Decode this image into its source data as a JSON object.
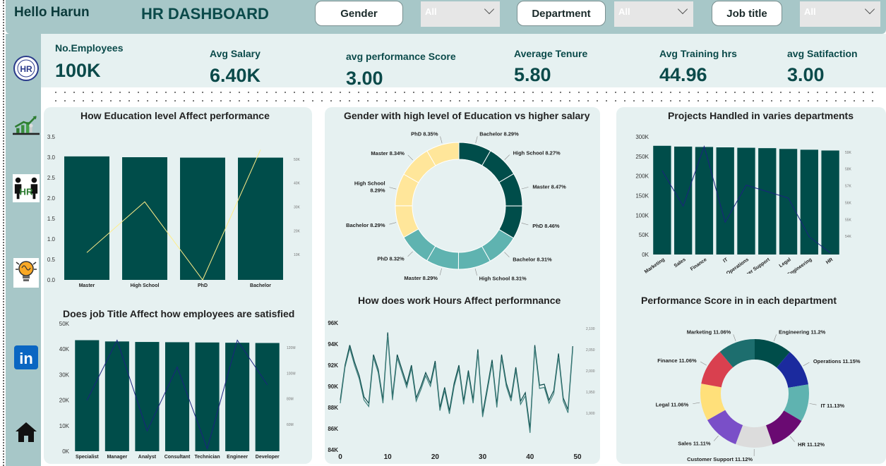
{
  "header": {
    "greeting": "Hello Harun",
    "title": "HR DASHBOARD",
    "filters": [
      {
        "label": "Gender",
        "value": "All"
      },
      {
        "label": "Department",
        "value": "All"
      },
      {
        "label": "Job  title",
        "value": "All"
      }
    ]
  },
  "sidebar": {
    "icons": [
      "hr-logo-icon",
      "growth-chart-icon",
      "hr-people-icon",
      "lightbulb-icon",
      "linkedin-icon",
      "home-icon"
    ],
    "linkedin_text": "in",
    "hr_text": "HR"
  },
  "kpis": [
    {
      "label": "No.Employees",
      "value": "100K"
    },
    {
      "label": "Avg Salary",
      "value": "6.40K"
    },
    {
      "label": "avg performance Score",
      "value": "3.00"
    },
    {
      "label": "Average Tenure",
      "value": "5.80"
    },
    {
      "label": "Avg Training hrs",
      "value": "44.96"
    },
    {
      "label": "avg Satifaction",
      "value": "3.00"
    }
  ],
  "colors": {
    "primary": "#004d4a",
    "line_yellow": "#ffee88",
    "line_blue": "#1a237e",
    "panel_bg": "#e6f1f1",
    "sidebar_bg": "#a7c7c8"
  },
  "chart_data": [
    {
      "type": "bar",
      "title": "How Education level Affect performance",
      "categories": [
        "Master",
        "High School",
        "PhD",
        "Bachelor"
      ],
      "series": [
        {
          "values": [
            3.02,
            3.0,
            2.99,
            2.99
          ]
        }
      ],
      "line": {
        "values": [
          10500,
          30000,
          0,
          50000
        ]
      },
      "ylim": [
        0,
        3.5
      ],
      "yticks": [
        "0.0",
        "0.5",
        "1.0",
        "1.5",
        "2.0",
        "2.5",
        "3.0",
        "3.5"
      ],
      "y2ticks": [
        "10K",
        "20K",
        "30K",
        "40K",
        "50K"
      ],
      "y2lim": [
        0,
        55000
      ]
    },
    {
      "type": "pie",
      "title": "Gender  with high level of Education vs higher salary",
      "slices": [
        {
          "label": "Bachelor 8.29%",
          "value": 8.29,
          "color": "#004d4a"
        },
        {
          "label": "High School 8.27%",
          "value": 8.27,
          "color": "#004d4a"
        },
        {
          "label": "Master 8.47%",
          "value": 8.47,
          "color": "#004d4a"
        },
        {
          "label": "PhD 8.46%",
          "value": 8.46,
          "color": "#004d4a"
        },
        {
          "label": "Bachelor 8.31%",
          "value": 8.31,
          "color": "#5fb3b0"
        },
        {
          "label": "High School 8.31%",
          "value": 8.31,
          "color": "#5fb3b0"
        },
        {
          "label": "Master 8.29%",
          "value": 8.29,
          "color": "#5fb3b0"
        },
        {
          "label": "PhD 8.32%",
          "value": 8.32,
          "color": "#5fb3b0"
        },
        {
          "label": "Bachelor 8.29%",
          "value": 8.29,
          "color": "#ffe69a"
        },
        {
          "label": "High School 8.29%",
          "value": 8.29,
          "color": "#ffe69a"
        },
        {
          "label": "Master 8.34%",
          "value": 8.34,
          "color": "#ffe69a"
        },
        {
          "label": "PhD 8.35%",
          "value": 8.35,
          "color": "#ffe69a"
        }
      ]
    },
    {
      "type": "bar",
      "title": "Projects Handled in varies departments",
      "categories": [
        "Marketing",
        "Sales",
        "Finance",
        "IT",
        "Operations",
        "Customer Support",
        "Legal",
        "Engineering",
        "HR"
      ],
      "series": [
        {
          "values": [
            277000,
            275000,
            274000,
            273000,
            272000,
            271000,
            269000,
            267000,
            265000
          ]
        }
      ],
      "line": {
        "values": [
          5790000,
          5570000,
          5940000,
          5470000,
          5700000,
          5660000,
          5620000,
          5380000,
          5280000
        ]
      },
      "ylim": [
        0,
        300000
      ],
      "yticks": [
        "0K",
        "50K",
        "100K",
        "150K",
        "200K",
        "250K",
        "300K"
      ],
      "y2ticks": [
        "54K",
        "55K",
        "56K",
        "57K",
        "58K",
        "59K"
      ],
      "y2lim": [
        5270000,
        6000000
      ]
    },
    {
      "type": "bar",
      "title": "Does job Title Affect how employees are satisfied",
      "categories": [
        "Specialist",
        "Manager",
        "Analyst",
        "Consultant",
        "Technician",
        "Engineer",
        "Developer"
      ],
      "series": [
        {
          "values": [
            43500,
            43000,
            42800,
            42700,
            42600,
            42500,
            42400
          ]
        }
      ],
      "line": {
        "values": [
          40000,
          87000,
          16000,
          66000,
          2000,
          87000,
          52000
        ]
      },
      "ylim": [
        0,
        50000
      ],
      "yticks": [
        "0K",
        "10K",
        "20K",
        "30K",
        "40K",
        "50K"
      ],
      "y2ticks": [
        "60M",
        "80M",
        "100M",
        "120M"
      ],
      "y2lim": [
        0,
        100000
      ]
    },
    {
      "type": "line",
      "title": "How does work Hours Affect performnance",
      "xlim": [
        0,
        50
      ],
      "xticks": [
        "0",
        "10",
        "20",
        "30",
        "40",
        "50"
      ],
      "ylim": [
        84000,
        96000
      ],
      "yticks": [
        "84K",
        "86K",
        "88K",
        "90K",
        "92K",
        "94K",
        "96K"
      ],
      "y2ticks": [
        "1,900",
        "1,950",
        "2,000",
        "2,050",
        "2,100"
      ],
      "series": [
        {
          "values": [
            88700,
            92000,
            93900,
            92300,
            91000,
            89000,
            88400,
            93000,
            91600,
            88700,
            95100,
            89000,
            93000,
            91600,
            90200,
            92000,
            88900,
            90000,
            91300,
            90300,
            92400,
            88000,
            89900,
            87700,
            90300,
            92000,
            88600,
            91500,
            88700,
            93500,
            87400,
            89900,
            92500,
            88300,
            93000,
            90300,
            88900,
            91800,
            88600,
            89400,
            86000,
            93900,
            90100,
            90200,
            88700,
            89600,
            93100,
            88900,
            87800,
            93800
          ]
        },
        {
          "values": [
            88400,
            91800,
            93600,
            92000,
            90700,
            88700,
            88100,
            92700,
            91300,
            88400,
            94800,
            88700,
            92700,
            91300,
            89900,
            91700,
            88600,
            89700,
            91000,
            90000,
            92100,
            87700,
            89600,
            87400,
            90000,
            91700,
            88300,
            91200,
            88400,
            93200,
            87100,
            89600,
            92200,
            88000,
            92700,
            90000,
            88600,
            91500,
            88300,
            89100,
            85600,
            93600,
            89800,
            89900,
            88400,
            89300,
            92800,
            88600,
            87500,
            93500
          ]
        }
      ]
    },
    {
      "type": "pie",
      "title": "Performance   Score in in each department",
      "slices": [
        {
          "label": "Engineering 11.2%",
          "value": 11.2,
          "color": "#004d4a"
        },
        {
          "label": "Operations 11.15%",
          "value": 11.15,
          "color": "#1b2a9e"
        },
        {
          "label": "IT 11.13%",
          "value": 11.13,
          "color": "#5fb3b0"
        },
        {
          "label": "HR 11.12%",
          "value": 11.12,
          "color": "#6a0a72"
        },
        {
          "label": "Customer Support 11.12%",
          "value": 11.12,
          "color": "#dcdcdc"
        },
        {
          "label": "Sales 11.11%",
          "value": 11.11,
          "color": "#7a4fc8"
        },
        {
          "label": "Legal 11.06%",
          "value": 11.06,
          "color": "#ffe07a"
        },
        {
          "label": "Finance 11.06%",
          "value": 11.06,
          "color": "#d9404f"
        },
        {
          "label": "Marketing 11.06%",
          "value": 11.06,
          "color": "#1d6e6e"
        }
      ]
    }
  ]
}
